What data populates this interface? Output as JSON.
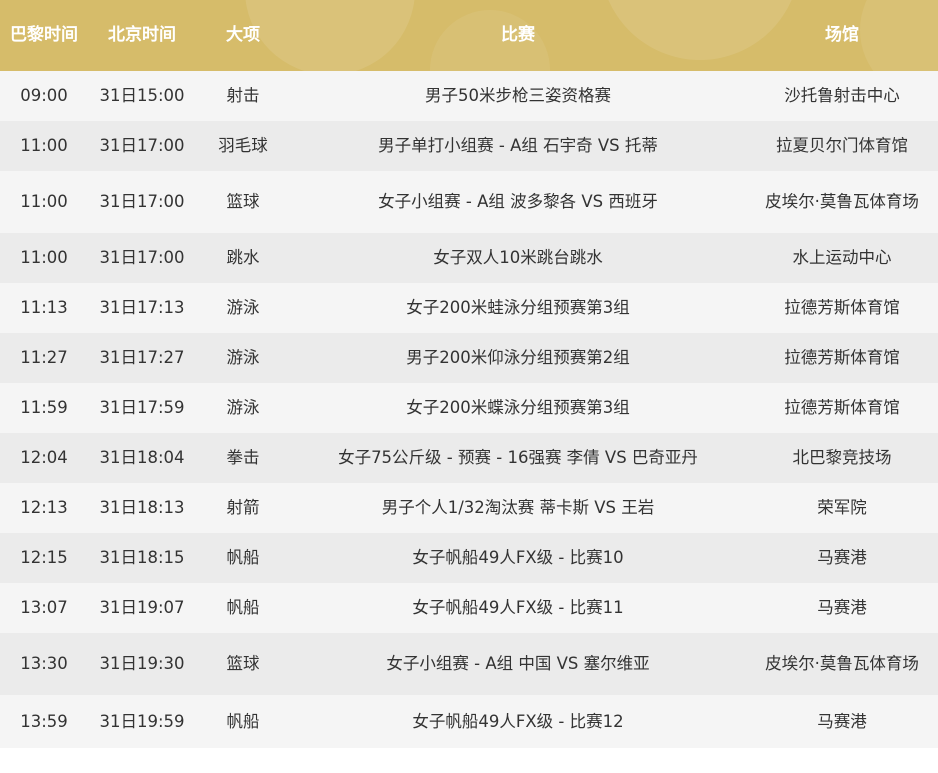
{
  "colors": {
    "header_bg": "#d6bc6a",
    "header_text": "#ffffff",
    "row_odd": "#f5f5f5",
    "row_even": "#ebebeb",
    "body_text": "#333333"
  },
  "headers": {
    "paris_time": "巴黎时间",
    "beijing_time": "北京时间",
    "sport": "大项",
    "event": "比赛",
    "venue": "场馆"
  },
  "rows": [
    {
      "paris": "09:00",
      "beijing": "31日15:00",
      "sport": "射击",
      "event": "男子50米步枪三姿资格赛",
      "venue": "沙托鲁射击中心"
    },
    {
      "paris": "11:00",
      "beijing": "31日17:00",
      "sport": "羽毛球",
      "event": "男子单打小组赛 - A组 石宇奇 VS 托蒂",
      "venue": "拉夏贝尔门体育馆"
    },
    {
      "paris": "11:00",
      "beijing": "31日17:00",
      "sport": "篮球",
      "event": "女子小组赛 - A组 波多黎各 VS 西班牙",
      "venue": "皮埃尔·莫鲁瓦体育场"
    },
    {
      "paris": "11:00",
      "beijing": "31日17:00",
      "sport": "跳水",
      "event": "女子双人10米跳台跳水",
      "venue": "水上运动中心"
    },
    {
      "paris": "11:13",
      "beijing": "31日17:13",
      "sport": "游泳",
      "event": "女子200米蛙泳分组预赛第3组",
      "venue": "拉德芳斯体育馆"
    },
    {
      "paris": "11:27",
      "beijing": "31日17:27",
      "sport": "游泳",
      "event": "男子200米仰泳分组预赛第2组",
      "venue": "拉德芳斯体育馆"
    },
    {
      "paris": "11:59",
      "beijing": "31日17:59",
      "sport": "游泳",
      "event": "女子200米蝶泳分组预赛第3组",
      "venue": "拉德芳斯体育馆"
    },
    {
      "paris": "12:04",
      "beijing": "31日18:04",
      "sport": "拳击",
      "event": "女子75公斤级 - 预赛 - 16强赛 李倩 VS 巴奇亚丹",
      "venue": "北巴黎竞技场"
    },
    {
      "paris": "12:13",
      "beijing": "31日18:13",
      "sport": "射箭",
      "event": "男子个人1/32淘汰赛 蒂卡斯 VS 王岩",
      "venue": "荣军院"
    },
    {
      "paris": "12:15",
      "beijing": "31日18:15",
      "sport": "帆船",
      "event": "女子帆船49人FX级 - 比赛10",
      "venue": "马赛港"
    },
    {
      "paris": "13:07",
      "beijing": "31日19:07",
      "sport": "帆船",
      "event": "女子帆船49人FX级 - 比赛11",
      "venue": "马赛港"
    },
    {
      "paris": "13:30",
      "beijing": "31日19:30",
      "sport": "篮球",
      "event": "女子小组赛 - A组 中国 VS 塞尔维亚",
      "venue": "皮埃尔·莫鲁瓦体育场"
    },
    {
      "paris": "13:59",
      "beijing": "31日19:59",
      "sport": "帆船",
      "event": "女子帆船49人FX级 - 比赛12",
      "venue": "马赛港"
    }
  ]
}
